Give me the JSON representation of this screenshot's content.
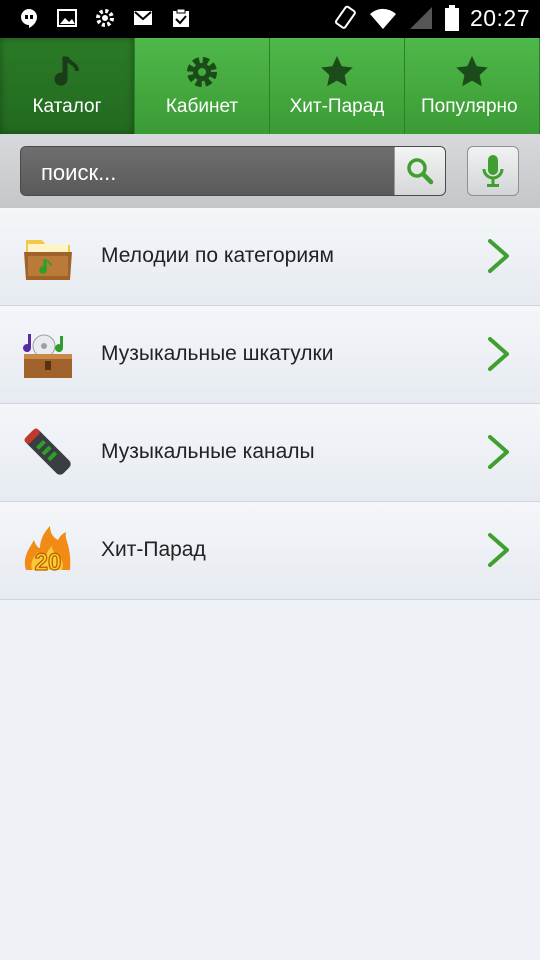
{
  "status_bar": {
    "time": "20:27",
    "left_icons": [
      "hangouts-icon",
      "image-icon",
      "settings-icon",
      "mail-icon",
      "clipboard-check-icon"
    ],
    "right_icons": [
      "vibrate-icon",
      "wifi-icon",
      "signal-icon",
      "battery-icon"
    ]
  },
  "tabs": [
    {
      "label": "Каталог",
      "icon": "music-note-icon",
      "active": true
    },
    {
      "label": "Кабинет",
      "icon": "gear-icon",
      "active": false
    },
    {
      "label": "Хит-Парад",
      "icon": "star-icon",
      "active": false
    },
    {
      "label": "Популярно",
      "icon": "star-icon",
      "active": false
    }
  ],
  "search": {
    "placeholder": "поиск..."
  },
  "list": [
    {
      "label": "Мелодии по категориям",
      "icon": "folder-music-icon"
    },
    {
      "label": "Музыкальные шкатулки",
      "icon": "music-box-icon"
    },
    {
      "label": "Музыкальные каналы",
      "icon": "remote-channel-icon"
    },
    {
      "label": "Хит-Парад",
      "icon": "hit-20-flame-icon"
    }
  ],
  "colors": {
    "tab_green": "#43aa3e",
    "tab_active": "#26721f",
    "accent_green": "#3f9f2f"
  }
}
